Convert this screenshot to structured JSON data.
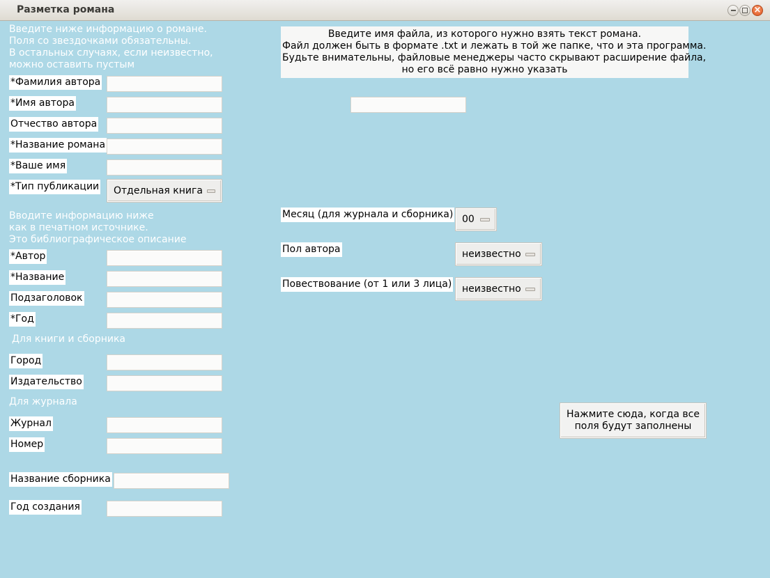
{
  "window": {
    "title": "Разметка романа"
  },
  "left": {
    "intro_hint": "Введите ниже информацию о романе.\nПоля со звездочками обязательны.\nВ остальных случаях, если неизвестно,\nможно оставить пустым",
    "author_surname_label": "*Фамилия автора",
    "author_name_label": "*Имя автора",
    "author_patronymic_label": "Отчество автора",
    "novel_title_label": "*Название романа",
    "your_name_label": "*Ваше имя",
    "publication_type_label": "*Тип публикации",
    "publication_type_value": "Отдельная книга",
    "biblio_hint": "Вводите информацию ниже\nкак в печатном источнике.\nЭто библиографическое описание",
    "biblio_author_label": "*Автор",
    "biblio_title_label": "*Название",
    "subtitle_label": "Подзаголовок",
    "year_label": "*Год",
    "book_hint": "Для книги и сборника",
    "city_label": "Город",
    "publisher_label": "Издательство",
    "journal_hint": "Для журнала",
    "journal_label": "Журнал",
    "issue_label": "Номер",
    "collection_title_label": "Название сборника",
    "creation_year_label": "Год создания"
  },
  "right": {
    "file_info_lines": [
      "Введите имя файла, из которого нужно взять текст романа.",
      "Файл должен быть в формате .txt и лежать в той же папке, что и эта программа.",
      "Будьте внимательны, файловые менеджеры часто скрывают расширение файла,",
      "но его всё равно нужно указать"
    ],
    "month_label": "Месяц (для журнала и сборника)",
    "month_value": "00",
    "author_gender_label": "Пол автора",
    "author_gender_value": "неизвестно",
    "narration_label": "Повествование (от 1 или 3 лица)",
    "narration_value": "неизвестно",
    "submit_lines": [
      "Нажмите сюда, когда все",
      "поля будут заполнены"
    ]
  }
}
